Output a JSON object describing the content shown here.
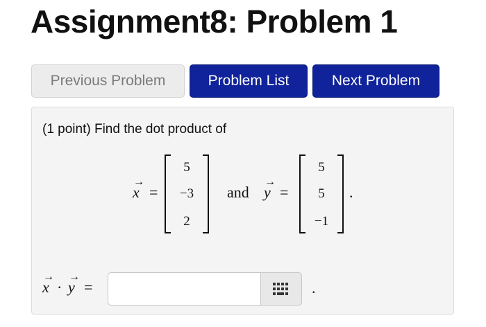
{
  "page": {
    "title": "Assignment8: Problem 1"
  },
  "nav": {
    "previous_label": "Previous Problem",
    "list_label": "Problem List",
    "next_label": "Next Problem"
  },
  "problem": {
    "prompt": "(1 point) Find the dot product of",
    "x_name": "x",
    "y_name": "y",
    "x_vector": [
      "5",
      "−3",
      "2"
    ],
    "y_vector": [
      "5",
      "5",
      "−1"
    ],
    "conjunction": "and",
    "end_period": ".",
    "dot_operator": "·",
    "equals": "="
  },
  "answer": {
    "value": "",
    "trailing_period": ".",
    "keyboard_icon": "keypad-icon"
  }
}
